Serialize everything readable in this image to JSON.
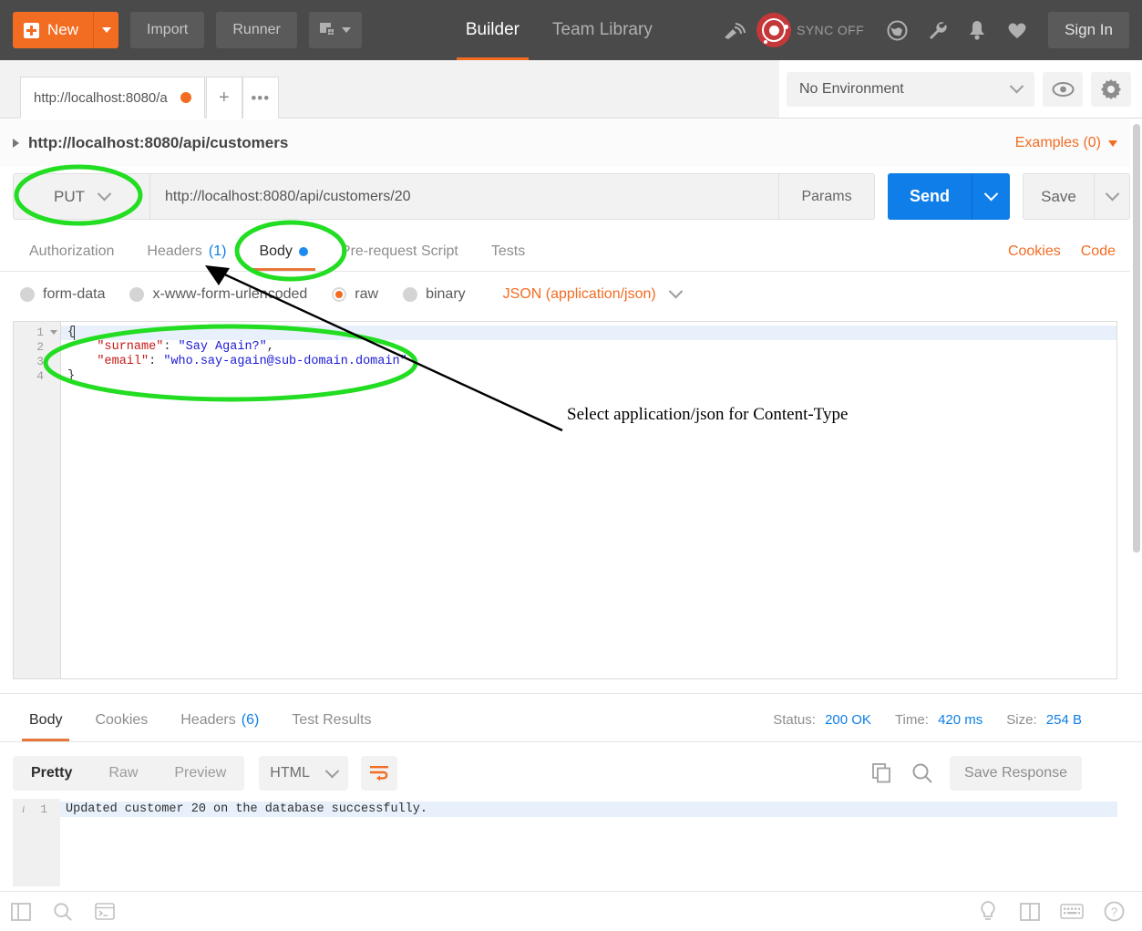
{
  "topbar": {
    "new_label": "New",
    "import_label": "Import",
    "runner_label": "Runner",
    "nav": [
      {
        "label": "Builder",
        "active": true
      },
      {
        "label": "Team Library",
        "active": false
      }
    ],
    "sync_label": "SYNC OFF",
    "signin_label": "Sign In",
    "accent_orange": "#f26c22",
    "bar_bg": "#4a4a4a"
  },
  "tabstrip": {
    "request_tab_label": "http://localhost:8080/a",
    "new_tab_label": "+",
    "more_tabs_label": "•••"
  },
  "environment": {
    "selected": "No Environment"
  },
  "request": {
    "breadcrumb": "http://localhost:8080/api/customers",
    "examples_label": "Examples (0)",
    "method": "PUT",
    "url": "http://localhost:8080/api/customers/20",
    "params_label": "Params",
    "send_label": "Send",
    "save_label": "Save",
    "tabs": [
      {
        "label": "Authorization",
        "active": false,
        "count": "",
        "dot": false
      },
      {
        "label": "Headers",
        "active": false,
        "count": "(1)",
        "dot": false
      },
      {
        "label": "Body",
        "active": true,
        "count": "",
        "dot": true
      },
      {
        "label": "Pre-request Script",
        "active": false,
        "count": "",
        "dot": false
      },
      {
        "label": "Tests",
        "active": false,
        "count": "",
        "dot": false
      }
    ],
    "cookies_link": "Cookies",
    "code_link": "Code",
    "body_types": [
      {
        "label": "form-data",
        "checked": false
      },
      {
        "label": "x-www-form-urlencoded",
        "checked": false
      },
      {
        "label": "raw",
        "checked": true
      },
      {
        "label": "binary",
        "checked": false
      }
    ],
    "content_type": "JSON (application/json)",
    "body_lines": [
      {
        "num": "1",
        "fold": true,
        "highlight": true,
        "parts": [
          {
            "t": "punc",
            "v": "{"
          }
        ]
      },
      {
        "num": "2",
        "fold": false,
        "highlight": false,
        "parts": [
          {
            "t": "punc",
            "v": "    "
          },
          {
            "t": "key",
            "v": "\"surname\""
          },
          {
            "t": "punc",
            "v": ": "
          },
          {
            "t": "str",
            "v": "\"Say Again?\""
          },
          {
            "t": "punc",
            "v": ","
          }
        ]
      },
      {
        "num": "3",
        "fold": false,
        "highlight": false,
        "parts": [
          {
            "t": "punc",
            "v": "    "
          },
          {
            "t": "key",
            "v": "\"email\""
          },
          {
            "t": "punc",
            "v": ": "
          },
          {
            "t": "str",
            "v": "\"who.say-again@sub-domain.domain\""
          }
        ]
      },
      {
        "num": "4",
        "fold": false,
        "highlight": false,
        "parts": [
          {
            "t": "punc",
            "v": "}"
          }
        ]
      }
    ]
  },
  "response": {
    "tabs": [
      {
        "label": "Body",
        "active": true,
        "count": ""
      },
      {
        "label": "Cookies",
        "active": false,
        "count": ""
      },
      {
        "label": "Headers",
        "active": false,
        "count": "(6)"
      },
      {
        "label": "Test Results",
        "active": false,
        "count": ""
      }
    ],
    "status_label": "Status:",
    "status_value": "200 OK",
    "time_label": "Time:",
    "time_value": "420 ms",
    "size_label": "Size:",
    "size_value": "254 B",
    "view_modes": [
      {
        "label": "Pretty",
        "active": true
      },
      {
        "label": "Raw",
        "active": false
      },
      {
        "label": "Preview",
        "active": false
      }
    ],
    "format": "HTML",
    "save_response_label": "Save Response",
    "body_line_num": "1",
    "body_text": "Updated customer 20 on the database successfully."
  },
  "annotations": {
    "note_text": "Select application/json for Content-Type",
    "highlight_color": "#22dd22",
    "arrow_color": "#000000"
  },
  "icons": {
    "satellite": "satellite-icon",
    "sync_logo": "postman-sync-logo",
    "globe": "globe-icon",
    "wrench": "wrench-icon",
    "bell": "bell-icon",
    "heart": "heart-icon",
    "eye": "eye-icon",
    "gear": "gear-icon",
    "copy": "copy-icon",
    "search": "search-icon",
    "wrap": "wrap-lines-icon",
    "sidebar": "sidebar-toggle-icon",
    "console": "console-icon",
    "bulb": "bulb-icon",
    "two_pane": "two-pane-layout-icon",
    "keyboard": "keyboard-icon",
    "help": "help-icon"
  }
}
